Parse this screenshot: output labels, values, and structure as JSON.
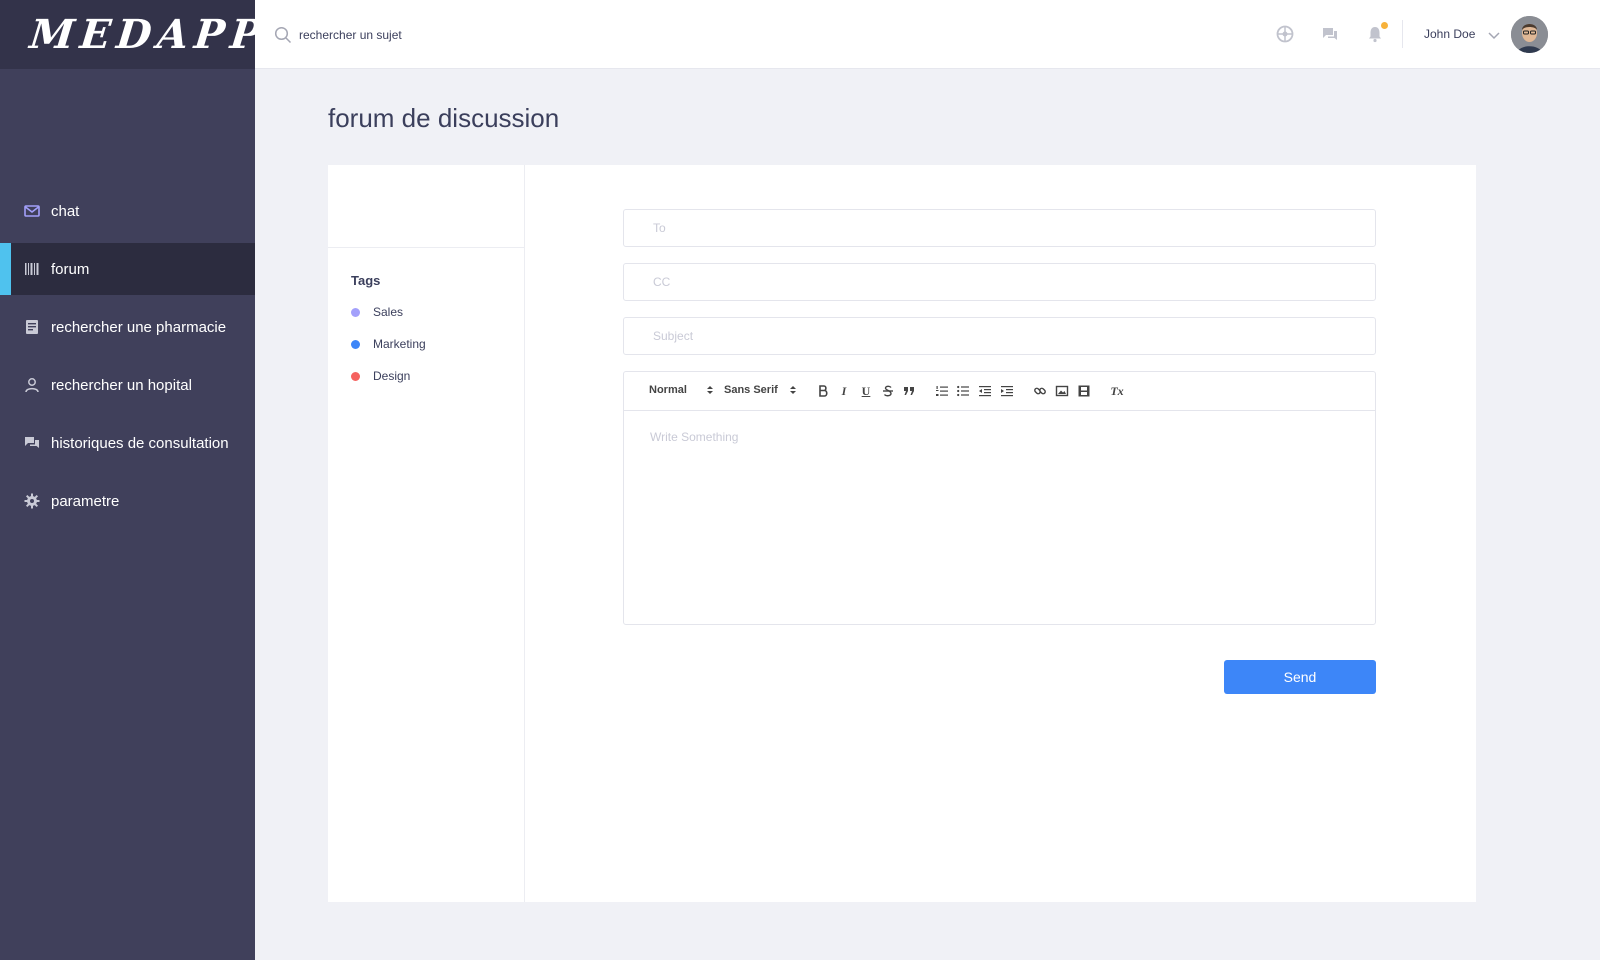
{
  "app": {
    "logo": "MEDAPP"
  },
  "sidebar": {
    "items": [
      {
        "label": "chat",
        "icon": "mail-icon",
        "active": false
      },
      {
        "label": "forum",
        "icon": "barcode-icon",
        "active": true
      },
      {
        "label": "rechercher une pharmacie",
        "icon": "document-icon",
        "active": false
      },
      {
        "label": "rechercher un hopital",
        "icon": "user-icon",
        "active": false
      },
      {
        "label": "historiques de consultation",
        "icon": "chat-bubbles-icon",
        "active": false
      },
      {
        "label": "parametre",
        "icon": "gear-icon",
        "active": false
      }
    ]
  },
  "topbar": {
    "search_value": "rechercher un sujet",
    "icons": [
      "globe-icon",
      "chat-icon",
      "bell-icon"
    ],
    "notification_dot_color": "#f7b23b",
    "user_name": "John Doe"
  },
  "page": {
    "title": "forum de discussion"
  },
  "tags": {
    "title": "Tags",
    "items": [
      {
        "label": "Sales",
        "color": "#a3a0fb"
      },
      {
        "label": "Marketing",
        "color": "#3d86f8"
      },
      {
        "label": "Design",
        "color": "#f5625f"
      }
    ]
  },
  "compose": {
    "to_placeholder": "To",
    "cc_placeholder": "CC",
    "subject_placeholder": "Subject",
    "toolbar": {
      "heading_select": "Normal",
      "font_select": "Sans Serif",
      "italic_glyph": "I",
      "underline_glyph": "U",
      "clean_glyph": "Tx"
    },
    "body_placeholder": "Write Something",
    "send_label": "Send"
  },
  "colors": {
    "sidebar_bg": "#40405b",
    "sidebar_active_bg": "#2c2c3f",
    "active_indicator": "#4fc2ee",
    "primary": "#3d86f8"
  }
}
